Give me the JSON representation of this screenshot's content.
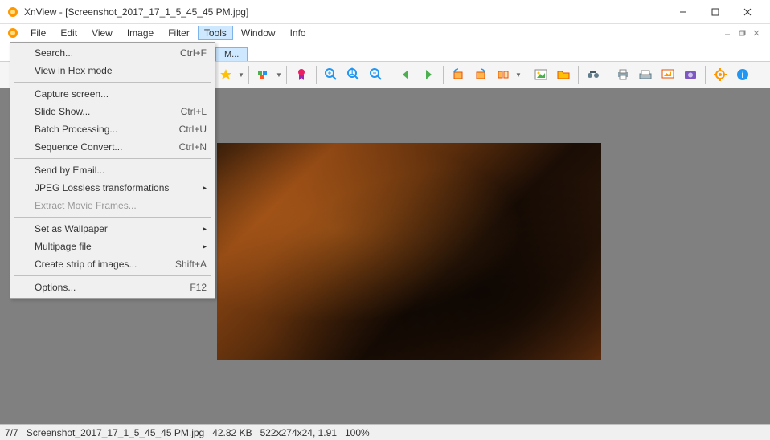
{
  "window": {
    "title": "XnView - [Screenshot_2017_17_1_5_45_45 PM.jpg]"
  },
  "menubar": {
    "items": [
      "File",
      "Edit",
      "View",
      "Image",
      "Filter",
      "Tools",
      "Window",
      "Info"
    ],
    "active_index": 5
  },
  "tools_menu": {
    "groups": [
      [
        {
          "label": "Search...",
          "shortcut": "Ctrl+F"
        },
        {
          "label": "View in Hex mode",
          "shortcut": ""
        }
      ],
      [
        {
          "label": "Capture screen...",
          "shortcut": ""
        },
        {
          "label": "Slide Show...",
          "shortcut": "Ctrl+L"
        },
        {
          "label": "Batch Processing...",
          "shortcut": "Ctrl+U"
        },
        {
          "label": "Sequence Convert...",
          "shortcut": "Ctrl+N"
        }
      ],
      [
        {
          "label": "Send by Email...",
          "shortcut": ""
        },
        {
          "label": "JPEG Lossless transformations",
          "shortcut": "",
          "submenu": true
        },
        {
          "label": "Extract Movie Frames...",
          "shortcut": "",
          "disabled": true
        }
      ],
      [
        {
          "label": "Set as Wallpaper",
          "shortcut": "",
          "submenu": true
        },
        {
          "label": "Multipage file",
          "shortcut": "",
          "submenu": true
        },
        {
          "label": "Create strip of images...",
          "shortcut": "Shift+A"
        }
      ],
      [
        {
          "label": "Options...",
          "shortcut": "F12"
        }
      ]
    ]
  },
  "tab": {
    "label": "M..."
  },
  "statusbar": {
    "index": "7/7",
    "filename": "Screenshot_2017_17_1_5_45_45 PM.jpg",
    "filesize": "42.82 KB",
    "dimensions": "522x274x24, 1.91",
    "zoom": "100%"
  },
  "toolbar_icons": [
    "star-icon",
    "dropdown",
    "sep",
    "palette-icon",
    "dropdown",
    "sep",
    "ribbon-icon",
    "sep",
    "zoom-in-icon",
    "zoom-fit-icon",
    "zoom-out-icon",
    "sep",
    "arrow-left-icon",
    "arrow-right-icon",
    "sep",
    "rotate-left-icon",
    "rotate-right-icon",
    "flip-icon",
    "dropdown",
    "sep",
    "picture-icon",
    "folder-icon",
    "sep",
    "binoculars-icon",
    "sep",
    "print-icon",
    "scanner-icon",
    "slideshow-icon",
    "camera-icon",
    "sep",
    "gear-icon",
    "info-icon"
  ]
}
